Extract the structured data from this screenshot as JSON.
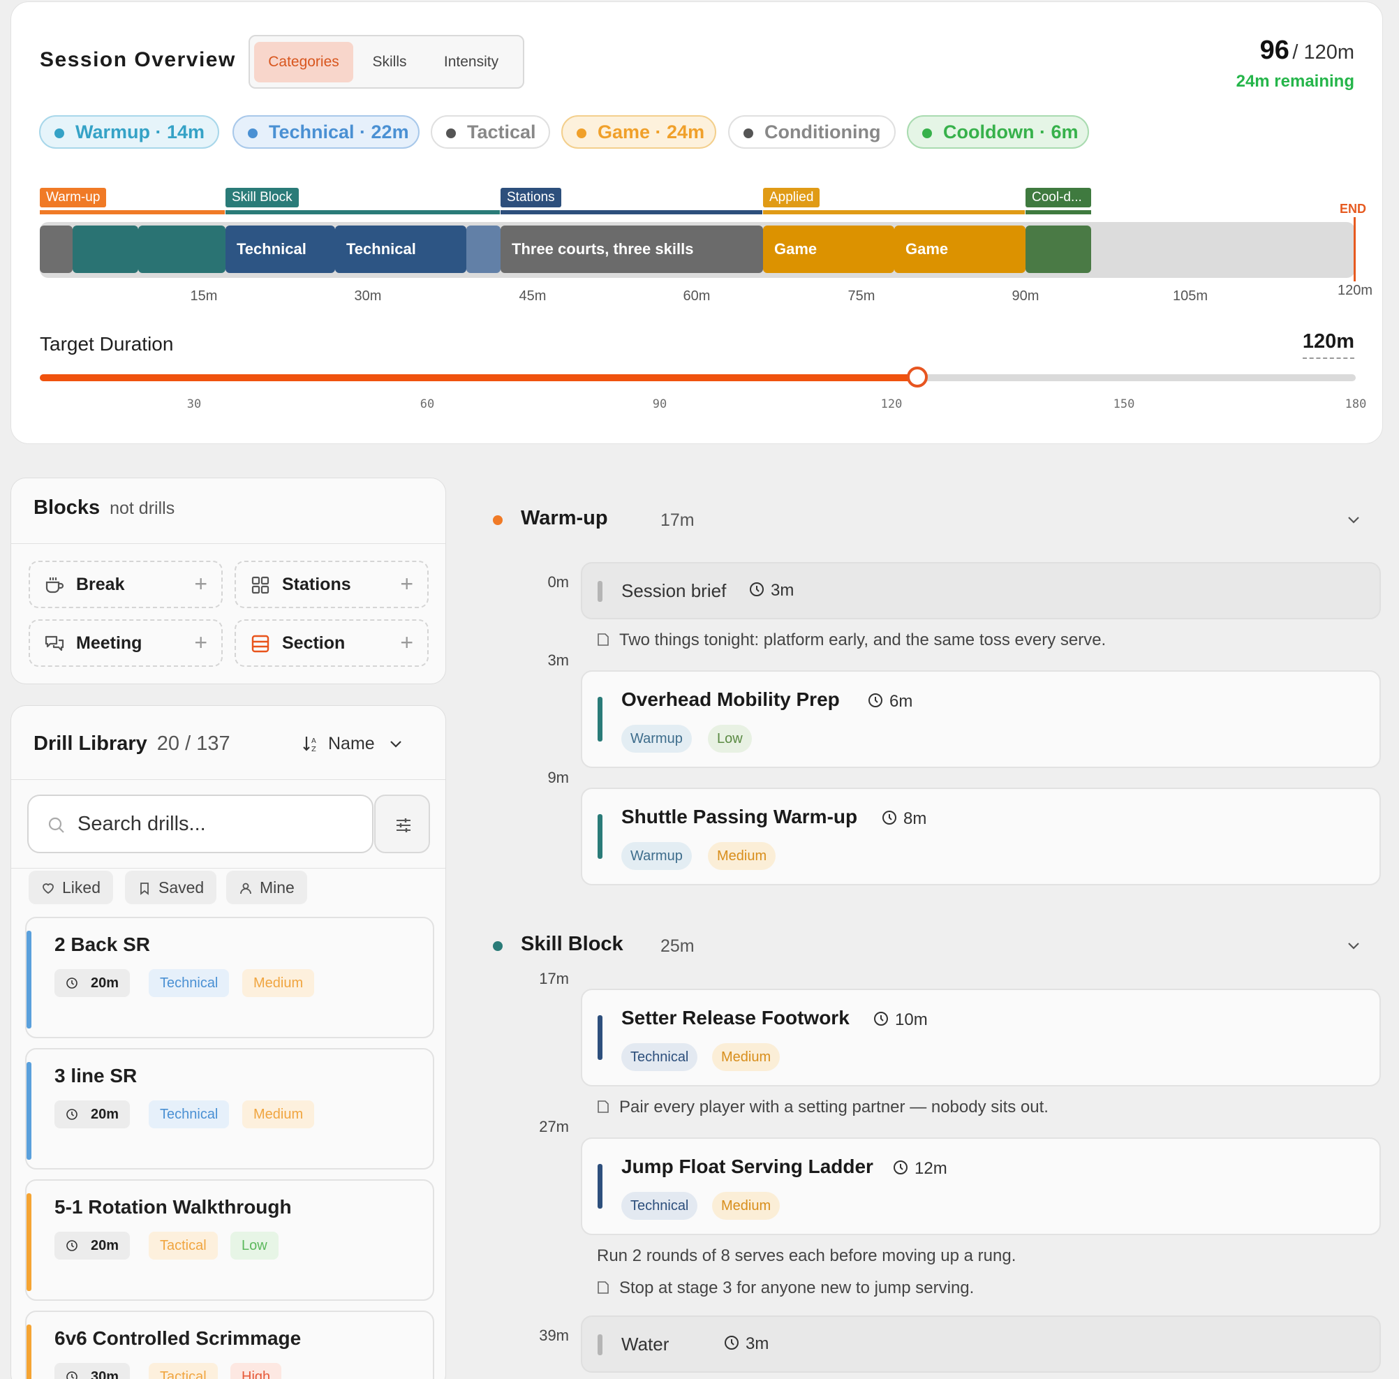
{
  "overview": {
    "title": "Session Overview",
    "tabs": [
      {
        "label": "Categories",
        "active": true
      },
      {
        "label": "Skills",
        "active": false
      },
      {
        "label": "Intensity",
        "active": false
      }
    ],
    "used_minutes": "96",
    "total_label": "/ 120m",
    "remaining": "24m remaining",
    "chips": [
      {
        "label": "Warmup · 14m",
        "color": "#3ba7c9"
      },
      {
        "label": "Technical · 22m",
        "color": "#4f95d6"
      },
      {
        "label": "Tactical",
        "color": "#8a8a8a"
      },
      {
        "label": "Game · 24m",
        "color": "#f2a12a"
      },
      {
        "label": "Conditioning",
        "color": "#8a8a8a"
      },
      {
        "label": "Cooldown · 6m",
        "color": "#3cb54e"
      }
    ],
    "phases": [
      {
        "label": "Warm-up",
        "color": "#f07a26"
      },
      {
        "label": "Skill Block",
        "color": "#2a7b78"
      },
      {
        "label": "Stations",
        "color": "#2d4f7c"
      },
      {
        "label": "Applied",
        "color": "#e09b16"
      },
      {
        "label": "Cool-d...",
        "color": "#3f7a3f"
      }
    ],
    "timeline_blocks": [
      {
        "label": "",
        "color": "#6e6e6e"
      },
      {
        "label": "",
        "color": "#2a7373"
      },
      {
        "label": "",
        "color": "#2a7373"
      },
      {
        "label": "Technical",
        "color": "#2d5584"
      },
      {
        "label": "Technical",
        "color": "#2d5584"
      },
      {
        "label": "",
        "color": "#6280a7"
      },
      {
        "label": "Three courts, three skills",
        "color": "#6b6b6b"
      },
      {
        "label": "Game",
        "color": "#dc9200"
      },
      {
        "label": "Game",
        "color": "#dc9200"
      },
      {
        "label": "",
        "color": "#4a7a45"
      }
    ],
    "end_label": "END",
    "axis_ticks": [
      "15m",
      "30m",
      "45m",
      "60m",
      "75m",
      "90m",
      "105m",
      "120m"
    ],
    "target": {
      "label": "Target Duration",
      "value_label": "120m",
      "value": 120,
      "min": 0,
      "max": 180,
      "ticks": [
        "30",
        "60",
        "90",
        "120",
        "150",
        "180"
      ]
    }
  },
  "blocks_panel": {
    "title": "Blocks",
    "subtitle": "not drills",
    "items": [
      {
        "label": "Break",
        "icon": "coffee-icon"
      },
      {
        "label": "Stations",
        "icon": "grid-icon"
      },
      {
        "label": "Meeting",
        "icon": "chat-icon"
      },
      {
        "label": "Section",
        "icon": "section-icon"
      }
    ]
  },
  "library": {
    "title": "Drill Library",
    "count": "20 / 137",
    "sort_label": "Name",
    "search_placeholder": "Search drills...",
    "filters": [
      "Liked",
      "Saved",
      "Mine"
    ],
    "drills": [
      {
        "title": "2 Back SR",
        "duration": "20m",
        "category": "Technical",
        "intensity": "Medium",
        "bar": "#5aa0dc"
      },
      {
        "title": "3 line SR",
        "duration": "20m",
        "category": "Technical",
        "intensity": "Medium",
        "bar": "#5aa0dc"
      },
      {
        "title": "5-1 Rotation Walkthrough",
        "duration": "20m",
        "category": "Tactical",
        "intensity": "Low",
        "bar": "#f5a433"
      },
      {
        "title": "6v6 Controlled Scrimmage",
        "duration": "30m",
        "category": "Tactical",
        "intensity": "High",
        "bar": "#f5a433"
      }
    ]
  },
  "plan": {
    "sections": [
      {
        "title": "Warm-up",
        "duration": "17m",
        "color": "#f07a26"
      },
      {
        "title": "Skill Block",
        "duration": "25m",
        "color": "#2a7b78"
      }
    ],
    "times": [
      "0m",
      "3m",
      "9m",
      "17m",
      "27m",
      "39m"
    ],
    "items": [
      {
        "title": "Session brief",
        "duration": "3m"
      },
      {
        "title": "Overhead Mobility Prep",
        "duration": "6m",
        "tags": [
          "Warmup",
          "Low"
        ]
      },
      {
        "title": "Shuttle Passing Warm-up",
        "duration": "8m",
        "tags": [
          "Warmup",
          "Medium"
        ]
      },
      {
        "title": "Setter Release Footwork",
        "duration": "10m",
        "tags": [
          "Technical",
          "Medium"
        ]
      },
      {
        "title": "Jump Float Serving Ladder",
        "duration": "12m",
        "tags": [
          "Technical",
          "Medium"
        ]
      },
      {
        "title": "Water",
        "duration": "3m"
      }
    ],
    "notes": [
      "Two things tonight: platform early, and the same toss every serve.",
      "Pair every player with a setting partner — nobody sits out.",
      "Run 2 rounds of 8 serves each before moving up a rung.",
      "Stop at stage 3 for anyone new to jump serving."
    ]
  }
}
